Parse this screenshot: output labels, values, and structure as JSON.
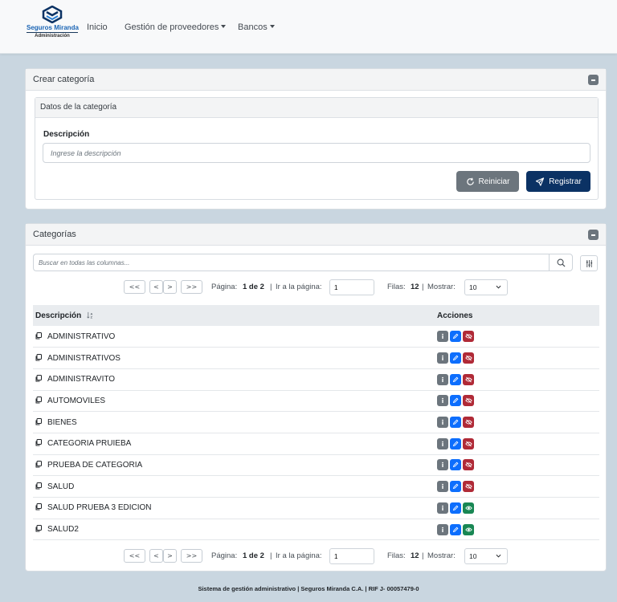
{
  "brand": {
    "name": "Seguros Miranda",
    "subtitle": "Administración"
  },
  "nav": {
    "inicio": "Inicio",
    "proveedores": "Gestión de proveedores",
    "bancos": "Bancos"
  },
  "create_card": {
    "title": "Crear categoría",
    "inner_title": "Datos de la categoría",
    "field_label": "Descripción",
    "placeholder": "Ingrese la descripción",
    "reset_label": "Reiniciar",
    "register_label": "Registrar"
  },
  "list_card": {
    "title": "Categorías",
    "search_placeholder": "Buscar en todas las columnas..."
  },
  "pagination": {
    "first": "<<",
    "prev": "<",
    "next": ">",
    "last": ">>",
    "page_label": "Página:",
    "page_value": "1 de 2",
    "sep1": "|",
    "goto_label": "Ir a la página:",
    "goto_value": "1",
    "rows_label": "Filas:",
    "rows_value": "12",
    "sep2": "|",
    "show_label": "Mostrar:",
    "show_value": "10"
  },
  "table": {
    "col_description": "Descripción",
    "col_actions": "Acciones",
    "rows": [
      {
        "description": "ADMINISTRATIVO",
        "active": true
      },
      {
        "description": "ADMINISTRATIVOS",
        "active": true
      },
      {
        "description": "ADMINISTRAVITO",
        "active": true
      },
      {
        "description": "AUTOMOVILES",
        "active": true
      },
      {
        "description": "BIENES",
        "active": true
      },
      {
        "description": "CATEGORIA PRUIEBA",
        "active": true
      },
      {
        "description": "PRUEBA DE CATEGORIA",
        "active": true
      },
      {
        "description": "SALUD",
        "active": true
      },
      {
        "description": "SALUD PRUEBA 3 EDICION",
        "active": false
      },
      {
        "description": "SALUD2",
        "active": false
      }
    ]
  },
  "footer": "Sistema de gestión administrativo | Seguros Miranda C.A. | RIF J- 00057479-0",
  "colors": {
    "navy": "#0b3264",
    "info": "#6c757d",
    "edit": "#0d6efd",
    "delete": "#b02a37",
    "activate": "#198754"
  }
}
